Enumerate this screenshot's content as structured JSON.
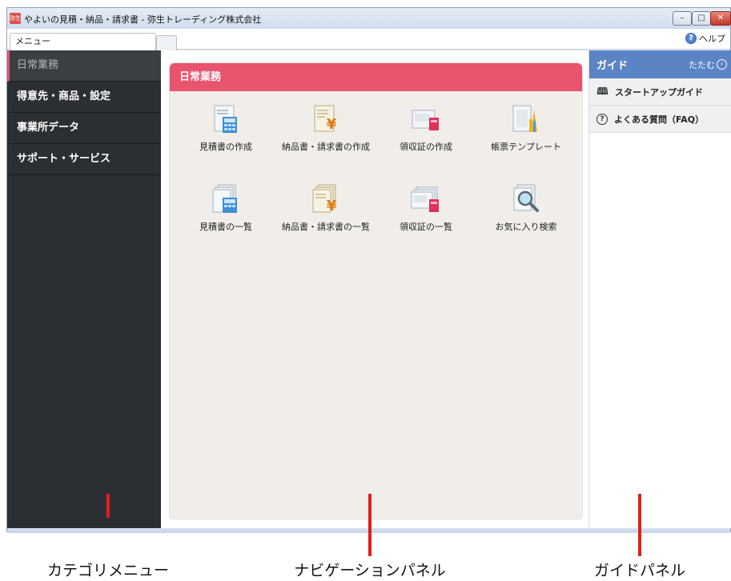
{
  "window": {
    "title": "やよいの見積・納品・請求書 - 弥生トレーディング株式会社",
    "app_icon_text": "弥生",
    "minimize_glyph": "–",
    "maximize_glyph": "□",
    "close_glyph": "✕"
  },
  "tabbar": {
    "tab_label": "メニュー",
    "help_label": "ヘルプ",
    "help_icon_glyph": "?"
  },
  "category_menu": {
    "items": [
      {
        "label": "日常業務",
        "active": true
      },
      {
        "label": "得意先・商品・設定"
      },
      {
        "label": "事業所データ"
      },
      {
        "label": "サポート・サービス"
      }
    ]
  },
  "nav_panel": {
    "header": "日常業務",
    "items": [
      {
        "label": "見積書の作成",
        "icon": "quote-create-icon"
      },
      {
        "label": "納品書・請求書の作成",
        "icon": "invoice-create-icon"
      },
      {
        "label": "領収証の作成",
        "icon": "receipt-create-icon"
      },
      {
        "label": "帳票テンプレート",
        "icon": "form-template-icon"
      },
      {
        "label": "見積書の一覧",
        "icon": "quote-list-icon"
      },
      {
        "label": "納品書・請求書の一覧",
        "icon": "invoice-list-icon"
      },
      {
        "label": "領収証の一覧",
        "icon": "receipt-list-icon"
      },
      {
        "label": "お気に入り検索",
        "icon": "favorite-search-icon"
      }
    ]
  },
  "guide_panel": {
    "title": "ガイド",
    "collapse_label": "たたむ",
    "collapse_glyph": "›",
    "items": [
      {
        "label": "スタートアップガイド",
        "icon": "map-icon",
        "glyph": "🕮"
      },
      {
        "label": "よくある質問（FAQ）",
        "icon": "question-circle-icon",
        "glyph": "?"
      }
    ]
  },
  "captions": {
    "category_menu": "カテゴリメニュー",
    "navigation_panel": "ナビゲーションパネル",
    "guide_panel": "ガイドパネル"
  },
  "colors": {
    "nav_header": "#e8536e",
    "guide_header": "#5b84c4",
    "category_bg": "#2b2f33",
    "pointer": "#e0201b"
  }
}
